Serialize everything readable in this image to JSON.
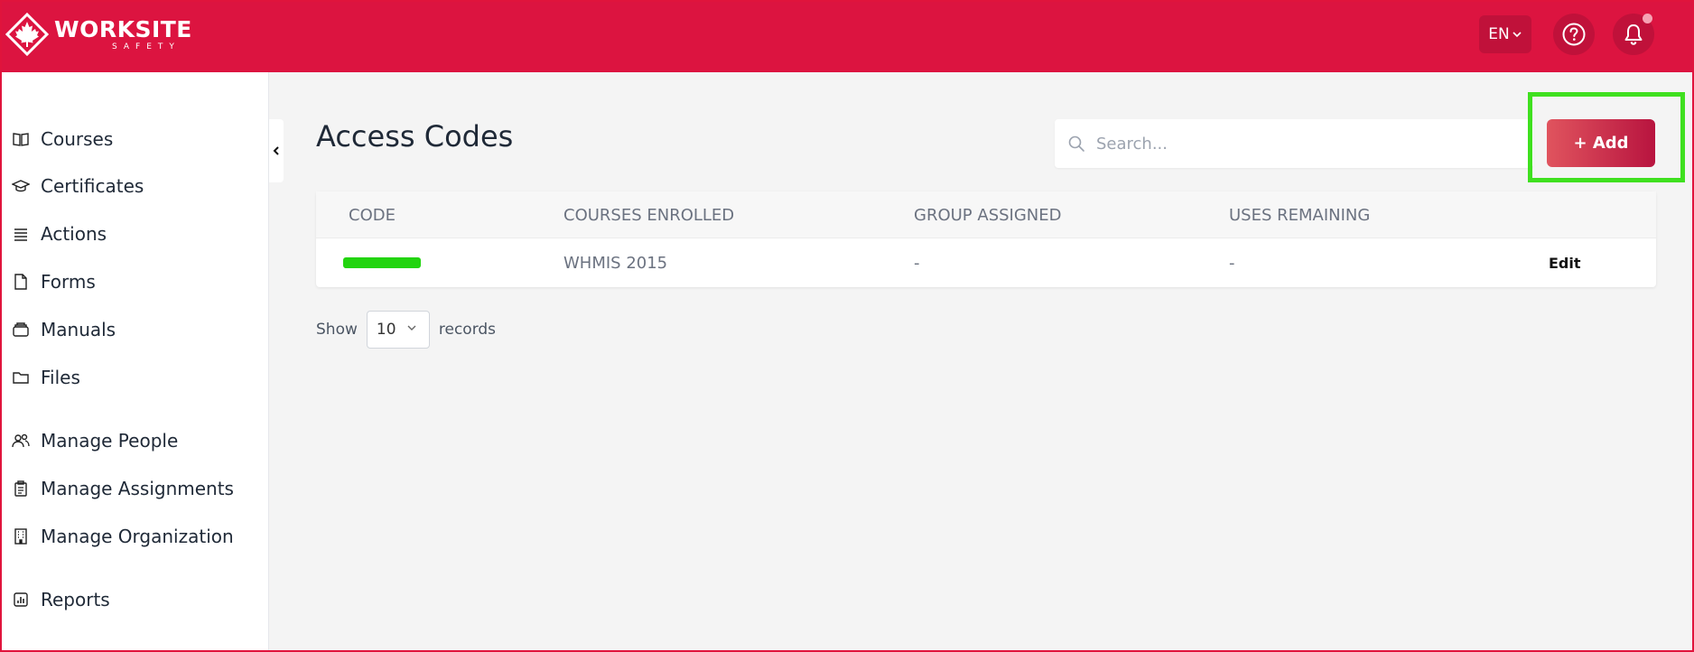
{
  "brand": {
    "name": "WORKSITE",
    "tagline": "SAFETY",
    "color_primary": "#dc1440"
  },
  "header": {
    "language": "EN",
    "help_icon": "question-circle-icon",
    "bell_icon": "bell-icon"
  },
  "sidebar": {
    "items": [
      {
        "label": "Courses",
        "icon": "book-open-icon"
      },
      {
        "label": "Certificates",
        "icon": "graduation-cap-icon"
      },
      {
        "label": "Actions",
        "icon": "list-icon"
      },
      {
        "label": "Forms",
        "icon": "file-icon"
      },
      {
        "label": "Manuals",
        "icon": "layers-icon"
      },
      {
        "label": "Files",
        "icon": "folder-icon"
      },
      {
        "label": "Manage People",
        "icon": "users-icon"
      },
      {
        "label": "Manage Assignments",
        "icon": "clipboard-icon"
      },
      {
        "label": "Manage Organization",
        "icon": "building-icon"
      },
      {
        "label": "Reports",
        "icon": "chart-icon"
      }
    ]
  },
  "main": {
    "title": "Access Codes",
    "search_placeholder": "Search...",
    "add_label": "+ Add",
    "table": {
      "headers": [
        "CODE",
        "COURSES ENROLLED",
        "GROUP ASSIGNED",
        "USES REMAINING"
      ],
      "rows": [
        {
          "courses": "WHMIS 2015",
          "group": "-",
          "uses": "-",
          "action": "Edit"
        }
      ]
    },
    "pagination": {
      "show_label": "Show",
      "page_size": "10",
      "records_label": "records"
    }
  }
}
